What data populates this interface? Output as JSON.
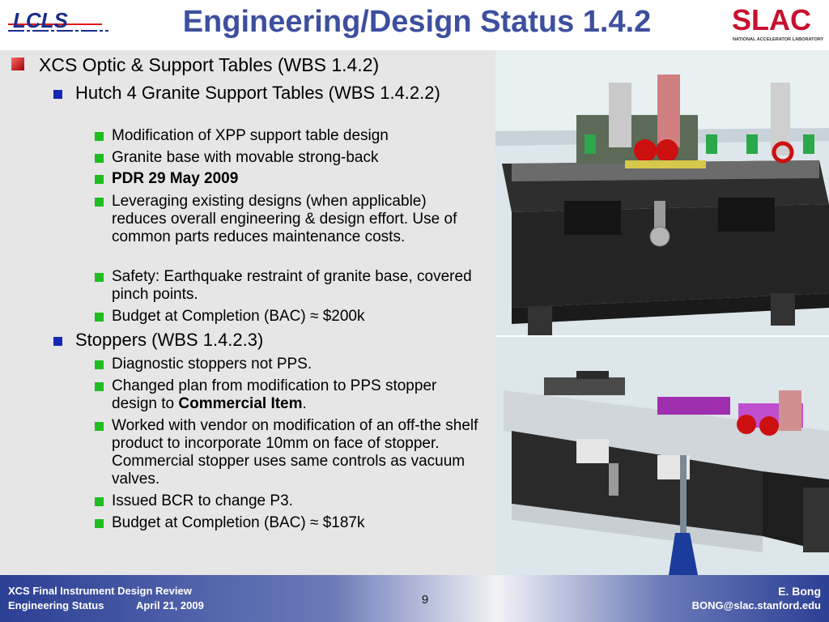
{
  "header": {
    "title": "Engineering/Design Status 1.4.2",
    "left_logo_text": "LCLS",
    "right_logo_text": "SLAC",
    "right_logo_subtext": "NATIONAL ACCELERATOR LABORATORY"
  },
  "content": {
    "heading": "XCS Optic & Support Tables (WBS 1.4.2)",
    "section1": {
      "title": "Hutch 4 Granite Support Tables (WBS 1.4.2.2)",
      "items": [
        "Modification of XPP support table design",
        "Granite base with movable strong-back",
        "PDR 29 May 2009",
        "Leveraging existing designs (when applicable) reduces overall engineering & design effort. Use of common parts reduces maintenance costs.",
        "Safety: Earthquake restraint of granite base, covered pinch points.",
        "Budget at Completion (BAC) ≈ $200k"
      ]
    },
    "section2": {
      "title": "Stoppers (WBS 1.4.2.3)",
      "items": [
        "Diagnostic stoppers not PPS.",
        "Changed plan from modification to PPS stopper design to ",
        "Commercial Item",
        ".",
        "Worked with vendor on modification of an off-the shelf product to incorporate 10mm on face of stopper. Commercial stopper uses same controls as vacuum valves.",
        "Issued BCR to change P3.",
        "Budget at Completion (BAC) ≈ $187k"
      ]
    }
  },
  "footer": {
    "left_line1": "XCS Final Instrument Design Review",
    "left_line2": "Engineering Status",
    "date": "April 21, 2009",
    "page_number": "9",
    "right_name": "E. Bong",
    "right_email": "BONG@slac.stanford.edu"
  }
}
